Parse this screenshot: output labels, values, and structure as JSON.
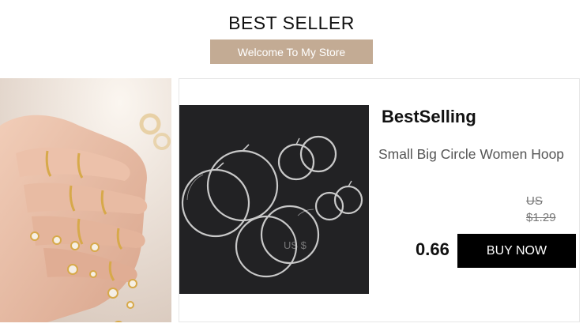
{
  "header": {
    "title": "BEST SELLER",
    "welcome_label": "Welcome To My Store"
  },
  "product": {
    "brand": "BestSelling",
    "name": "Small Big Circle Women Hoop",
    "old_price_currency": "US",
    "old_price": "$1.29",
    "watermark": "US $",
    "price": "0.66",
    "buy_label": "BUY NOW"
  },
  "colors": {
    "welcome_bg": "#c3ab94",
    "buy_bg": "#000000",
    "photo_bg": "#222224"
  }
}
